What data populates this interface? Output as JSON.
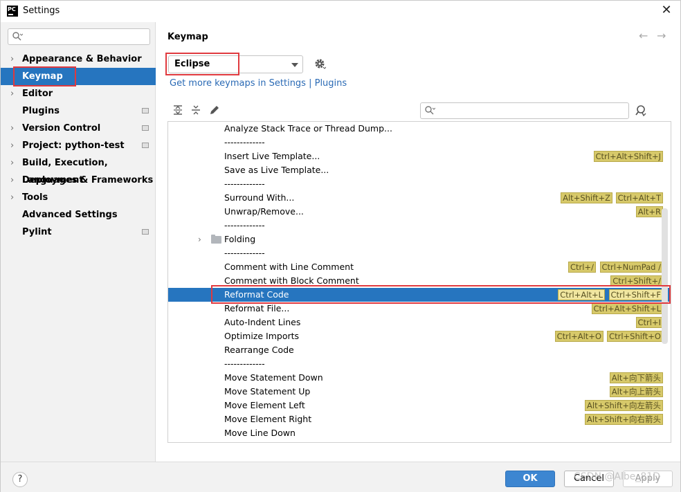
{
  "window": {
    "title": "Settings",
    "app_icon_text": "PC",
    "close_icon": "close-icon"
  },
  "sidebar": {
    "search_placeholder": "",
    "items": [
      {
        "label": "Appearance & Behavior",
        "expandable": true,
        "project_icon": false
      },
      {
        "label": "Keymap",
        "expandable": false,
        "project_icon": false,
        "selected": true
      },
      {
        "label": "Editor",
        "expandable": true,
        "project_icon": false
      },
      {
        "label": "Plugins",
        "expandable": false,
        "project_icon": true
      },
      {
        "label": "Version Control",
        "expandable": true,
        "project_icon": true
      },
      {
        "label": "Project: python-test",
        "expandable": true,
        "project_icon": true
      },
      {
        "label": "Build, Execution, Deployment",
        "expandable": true,
        "project_icon": false
      },
      {
        "label": "Languages & Frameworks",
        "expandable": true,
        "project_icon": false
      },
      {
        "label": "Tools",
        "expandable": true,
        "project_icon": false
      },
      {
        "label": "Advanced Settings",
        "expandable": false,
        "project_icon": false
      },
      {
        "label": "Pylint",
        "expandable": false,
        "project_icon": true
      }
    ]
  },
  "main": {
    "title": "Keymap",
    "keymap_value": "Eclipse",
    "more_keymaps_link": "Get more keymaps in Settings | Plugins",
    "search_placeholder": "",
    "rows": [
      {
        "text": "Analyze Stack Trace or Thread Dump...",
        "shortcuts": []
      },
      {
        "text": "-------------",
        "shortcuts": []
      },
      {
        "text": "Insert Live Template...",
        "shortcuts": [
          "Ctrl+Alt+Shift+J"
        ]
      },
      {
        "text": "Save as Live Template...",
        "shortcuts": []
      },
      {
        "text": "-------------",
        "shortcuts": []
      },
      {
        "text": "Surround With...",
        "shortcuts": [
          "Alt+Shift+Z",
          "Ctrl+Alt+T"
        ]
      },
      {
        "text": "Unwrap/Remove...",
        "shortcuts": [
          "Alt+R"
        ]
      },
      {
        "text": "-------------",
        "shortcuts": []
      },
      {
        "text": "Folding",
        "shortcuts": [],
        "folder": true
      },
      {
        "text": "-------------",
        "shortcuts": []
      },
      {
        "text": "Comment with Line Comment",
        "shortcuts": [
          "Ctrl+/",
          "Ctrl+NumPad /"
        ]
      },
      {
        "text": "Comment with Block Comment",
        "shortcuts": [
          "Ctrl+Shift+/"
        ]
      },
      {
        "text": "Reformat Code",
        "shortcuts": [
          "Ctrl+Alt+L",
          "Ctrl+Shift+F"
        ],
        "selected": true
      },
      {
        "text": "Reformat File...",
        "shortcuts": [
          "Ctrl+Alt+Shift+L"
        ]
      },
      {
        "text": "Auto-Indent Lines",
        "shortcuts": [
          "Ctrl+I"
        ]
      },
      {
        "text": "Optimize Imports",
        "shortcuts": [
          "Ctrl+Alt+O",
          "Ctrl+Shift+O"
        ]
      },
      {
        "text": "Rearrange Code",
        "shortcuts": []
      },
      {
        "text": "-------------",
        "shortcuts": []
      },
      {
        "text": "Move Statement Down",
        "shortcuts": [
          "Alt+向下箭头"
        ]
      },
      {
        "text": "Move Statement Up",
        "shortcuts": [
          "Alt+向上箭头"
        ]
      },
      {
        "text": "Move Element Left",
        "shortcuts": [
          "Alt+Shift+向左箭头"
        ]
      },
      {
        "text": "Move Element Right",
        "shortcuts": [
          "Alt+Shift+向右箭头"
        ]
      },
      {
        "text": "Move Line Down",
        "shortcuts": []
      }
    ]
  },
  "footer": {
    "help_label": "?",
    "ok_label": "OK",
    "cancel_label": "Cancel",
    "apply_label": "Apply"
  },
  "watermark": "CSDN @Albe_81D",
  "colors": {
    "selection": "#2675bf",
    "highlight_box": "#e0393e",
    "shortcut_bg": "#d7c96a",
    "link": "#2a6ab5"
  }
}
